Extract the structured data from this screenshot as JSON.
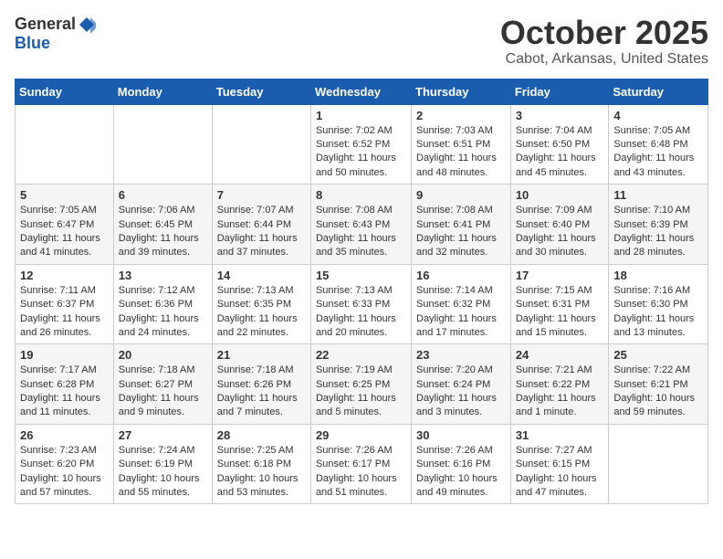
{
  "logo": {
    "general": "General",
    "blue": "Blue"
  },
  "title": "October 2025",
  "location": "Cabot, Arkansas, United States",
  "weekdays": [
    "Sunday",
    "Monday",
    "Tuesday",
    "Wednesday",
    "Thursday",
    "Friday",
    "Saturday"
  ],
  "weeks": [
    [
      {
        "day": "",
        "info": ""
      },
      {
        "day": "",
        "info": ""
      },
      {
        "day": "",
        "info": ""
      },
      {
        "day": "1",
        "info": "Sunrise: 7:02 AM\nSunset: 6:52 PM\nDaylight: 11 hours\nand 50 minutes."
      },
      {
        "day": "2",
        "info": "Sunrise: 7:03 AM\nSunset: 6:51 PM\nDaylight: 11 hours\nand 48 minutes."
      },
      {
        "day": "3",
        "info": "Sunrise: 7:04 AM\nSunset: 6:50 PM\nDaylight: 11 hours\nand 45 minutes."
      },
      {
        "day": "4",
        "info": "Sunrise: 7:05 AM\nSunset: 6:48 PM\nDaylight: 11 hours\nand 43 minutes."
      }
    ],
    [
      {
        "day": "5",
        "info": "Sunrise: 7:05 AM\nSunset: 6:47 PM\nDaylight: 11 hours\nand 41 minutes."
      },
      {
        "day": "6",
        "info": "Sunrise: 7:06 AM\nSunset: 6:45 PM\nDaylight: 11 hours\nand 39 minutes."
      },
      {
        "day": "7",
        "info": "Sunrise: 7:07 AM\nSunset: 6:44 PM\nDaylight: 11 hours\nand 37 minutes."
      },
      {
        "day": "8",
        "info": "Sunrise: 7:08 AM\nSunset: 6:43 PM\nDaylight: 11 hours\nand 35 minutes."
      },
      {
        "day": "9",
        "info": "Sunrise: 7:08 AM\nSunset: 6:41 PM\nDaylight: 11 hours\nand 32 minutes."
      },
      {
        "day": "10",
        "info": "Sunrise: 7:09 AM\nSunset: 6:40 PM\nDaylight: 11 hours\nand 30 minutes."
      },
      {
        "day": "11",
        "info": "Sunrise: 7:10 AM\nSunset: 6:39 PM\nDaylight: 11 hours\nand 28 minutes."
      }
    ],
    [
      {
        "day": "12",
        "info": "Sunrise: 7:11 AM\nSunset: 6:37 PM\nDaylight: 11 hours\nand 26 minutes."
      },
      {
        "day": "13",
        "info": "Sunrise: 7:12 AM\nSunset: 6:36 PM\nDaylight: 11 hours\nand 24 minutes."
      },
      {
        "day": "14",
        "info": "Sunrise: 7:13 AM\nSunset: 6:35 PM\nDaylight: 11 hours\nand 22 minutes."
      },
      {
        "day": "15",
        "info": "Sunrise: 7:13 AM\nSunset: 6:33 PM\nDaylight: 11 hours\nand 20 minutes."
      },
      {
        "day": "16",
        "info": "Sunrise: 7:14 AM\nSunset: 6:32 PM\nDaylight: 11 hours\nand 17 minutes."
      },
      {
        "day": "17",
        "info": "Sunrise: 7:15 AM\nSunset: 6:31 PM\nDaylight: 11 hours\nand 15 minutes."
      },
      {
        "day": "18",
        "info": "Sunrise: 7:16 AM\nSunset: 6:30 PM\nDaylight: 11 hours\nand 13 minutes."
      }
    ],
    [
      {
        "day": "19",
        "info": "Sunrise: 7:17 AM\nSunset: 6:28 PM\nDaylight: 11 hours\nand 11 minutes."
      },
      {
        "day": "20",
        "info": "Sunrise: 7:18 AM\nSunset: 6:27 PM\nDaylight: 11 hours\nand 9 minutes."
      },
      {
        "day": "21",
        "info": "Sunrise: 7:18 AM\nSunset: 6:26 PM\nDaylight: 11 hours\nand 7 minutes."
      },
      {
        "day": "22",
        "info": "Sunrise: 7:19 AM\nSunset: 6:25 PM\nDaylight: 11 hours\nand 5 minutes."
      },
      {
        "day": "23",
        "info": "Sunrise: 7:20 AM\nSunset: 6:24 PM\nDaylight: 11 hours\nand 3 minutes."
      },
      {
        "day": "24",
        "info": "Sunrise: 7:21 AM\nSunset: 6:22 PM\nDaylight: 11 hours\nand 1 minute."
      },
      {
        "day": "25",
        "info": "Sunrise: 7:22 AM\nSunset: 6:21 PM\nDaylight: 10 hours\nand 59 minutes."
      }
    ],
    [
      {
        "day": "26",
        "info": "Sunrise: 7:23 AM\nSunset: 6:20 PM\nDaylight: 10 hours\nand 57 minutes."
      },
      {
        "day": "27",
        "info": "Sunrise: 7:24 AM\nSunset: 6:19 PM\nDaylight: 10 hours\nand 55 minutes."
      },
      {
        "day": "28",
        "info": "Sunrise: 7:25 AM\nSunset: 6:18 PM\nDaylight: 10 hours\nand 53 minutes."
      },
      {
        "day": "29",
        "info": "Sunrise: 7:26 AM\nSunset: 6:17 PM\nDaylight: 10 hours\nand 51 minutes."
      },
      {
        "day": "30",
        "info": "Sunrise: 7:26 AM\nSunset: 6:16 PM\nDaylight: 10 hours\nand 49 minutes."
      },
      {
        "day": "31",
        "info": "Sunrise: 7:27 AM\nSunset: 6:15 PM\nDaylight: 10 hours\nand 47 minutes."
      },
      {
        "day": "",
        "info": ""
      }
    ]
  ]
}
